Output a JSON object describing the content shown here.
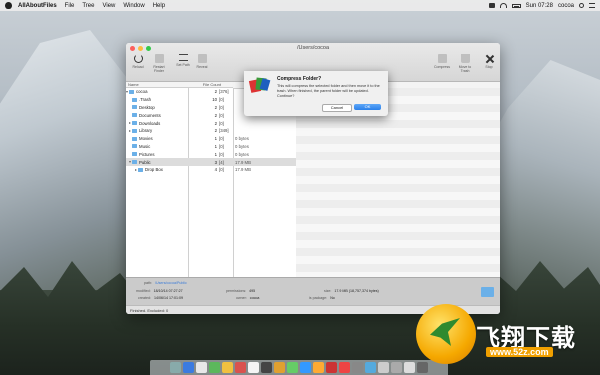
{
  "menubar": {
    "app_name": "AllAboutFiles",
    "menus": [
      "File",
      "Tree",
      "View",
      "Window",
      "Help"
    ],
    "clock": "Sun 07:28",
    "user": "cocoa"
  },
  "window": {
    "title": "/Users/cocoa",
    "toolbar": {
      "left": [
        "Reload",
        "Restart Finder",
        "Set Path",
        "Reveal"
      ],
      "right": [
        "Compress",
        "Move to Trash",
        "Stop"
      ]
    },
    "columns": {
      "name": "Name",
      "file_count": "File Count"
    },
    "tree": [
      {
        "name": "cocoa",
        "count": "2",
        "bracket": "[376]"
      },
      {
        "name": ".Trash",
        "count": "10",
        "bracket": "[0]"
      },
      {
        "name": "Desktop",
        "count": "2",
        "bracket": "[0]"
      },
      {
        "name": "Documents",
        "count": "2",
        "bracket": "[0]"
      },
      {
        "name": "Downloads",
        "count": "2",
        "bracket": "[0]"
      },
      {
        "name": "Library",
        "count": "2",
        "bracket": "[349]"
      },
      {
        "name": "Movies",
        "count": "1",
        "bracket": "[0]"
      },
      {
        "name": "Music",
        "count": "1",
        "bracket": "[0]"
      },
      {
        "name": "Pictures",
        "count": "1",
        "bracket": "[0]"
      },
      {
        "name": "Public",
        "count": "3",
        "bracket": "[4]"
      },
      {
        "name": "Drop Box",
        "count": "4",
        "bracket": "[0]"
      }
    ],
    "sizes": [
      "",
      "",
      "",
      "",
      "",
      "",
      "0 bytes",
      "0 bytes",
      "0 bytes",
      "17.9 MB",
      "17.9 MB"
    ],
    "info": {
      "path_label": "path:",
      "path": "/Users/cocoa/Public",
      "modified_label": "modified:",
      "modified": "18/10/14 07:27:27",
      "created_label": "created:",
      "created": "14/06/14 17:01:09",
      "permissions_label": "permissions:",
      "permissions": "495",
      "owner_label": "owner:",
      "owner": "cocoa",
      "size_label": "size:",
      "size": "17.9 MB (18,757,374 bytes)",
      "package_label": "is package:",
      "package": "No"
    },
    "status": "Finished. Excluded: 0"
  },
  "dialog": {
    "title": "Compress Folder?",
    "message": "This will compress the selected folder and then move it to the trash. When finished, the parent folder will be updated. Continue?",
    "cancel": "Cancel",
    "ok": "OK"
  },
  "dock_colors": [
    "#8aa",
    "#3b7be0",
    "#e8e8e8",
    "#5cb85c",
    "#f0c040",
    "#d9534f",
    "#f5f5f5",
    "#444",
    "#e0a030",
    "#6c6",
    "#39f",
    "#fa3",
    "#c33",
    "#e44",
    "#888",
    "#5ad",
    "#ccc",
    "#aaa",
    "#ddd",
    "#666"
  ],
  "watermark": {
    "text": "飞翔下载",
    "url": "www.52z.com"
  }
}
